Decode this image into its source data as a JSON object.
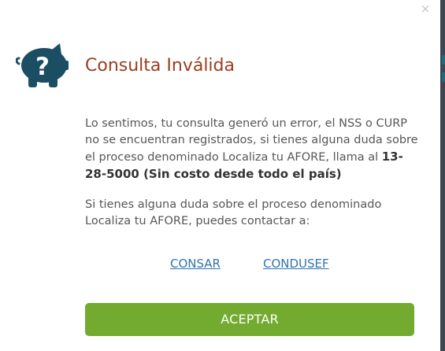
{
  "dialog": {
    "close_glyph": "×",
    "title": "Consulta Inválida",
    "icon": "piggy-bank-question-icon",
    "message_1": {
      "text": "Lo sentimos, tu consulta generó un error, el NSS o CURP no se encuentran registrados, si tienes alguna duda sobre el proceso denominado Localiza tu AFORE, llama al ",
      "phone_bold": "13-28-5000 (Sin costo desde todo el país)"
    },
    "message_2": "Si tienes alguna duda sobre el proceso denominado Localiza tu AFORE, puedes contactar a:",
    "links": [
      {
        "label": "CONSAR"
      },
      {
        "label": "CONDUSEF"
      }
    ],
    "accept_label": "ACEPTAR"
  },
  "colors": {
    "title": "#9c3d20",
    "icon": "#1b4e63",
    "link": "#2f74b0",
    "accept_button": "#72ab2f",
    "body_text": "#565656"
  }
}
